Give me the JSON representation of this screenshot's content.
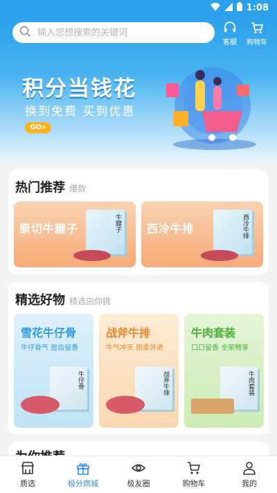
{
  "status": {
    "time": "1:08"
  },
  "header": {
    "search_placeholder": "输入您想搜索的关键词",
    "service_label": "客服",
    "cart_label": "购物车"
  },
  "banner": {
    "title": "积分当钱花",
    "subtitle": "换到免费  买到优惠",
    "go": "GO»"
  },
  "hot": {
    "title": "热门推荐",
    "tag": "爆款",
    "items": [
      {
        "name": "原切牛腱子",
        "box_label": "牛腱子"
      },
      {
        "name": "西冷牛排",
        "box_label": "西冷牛排"
      }
    ]
  },
  "selected": {
    "title": "精选好物",
    "tag": "精选由你挑",
    "items": [
      {
        "name": "雪花牛仔骨",
        "slogan": "牛仔骨气 唇齿留香",
        "box_label": "牛仔骨",
        "color": "#2f9be0"
      },
      {
        "name": "战斧牛排",
        "slogan": "牛气冲天 刚柔并进",
        "box_label": "战斧牛排",
        "color": "#e8872a"
      },
      {
        "name": "牛肉套装",
        "slogan": "口口留香 全家畅享",
        "box_label": "牛肉套装",
        "color": "#4caf3a"
      }
    ]
  },
  "recommend": {
    "title": "为你推荐"
  },
  "tabbar": {
    "items": [
      {
        "label": "质选"
      },
      {
        "label": "极分商城"
      },
      {
        "label": "极友圈"
      },
      {
        "label": "购物车"
      },
      {
        "label": "我的"
      }
    ]
  },
  "colors": {
    "accent": "#2f8fe6",
    "header_blue": "#2aa0ea",
    "go_yellow": "#ffb21e"
  }
}
